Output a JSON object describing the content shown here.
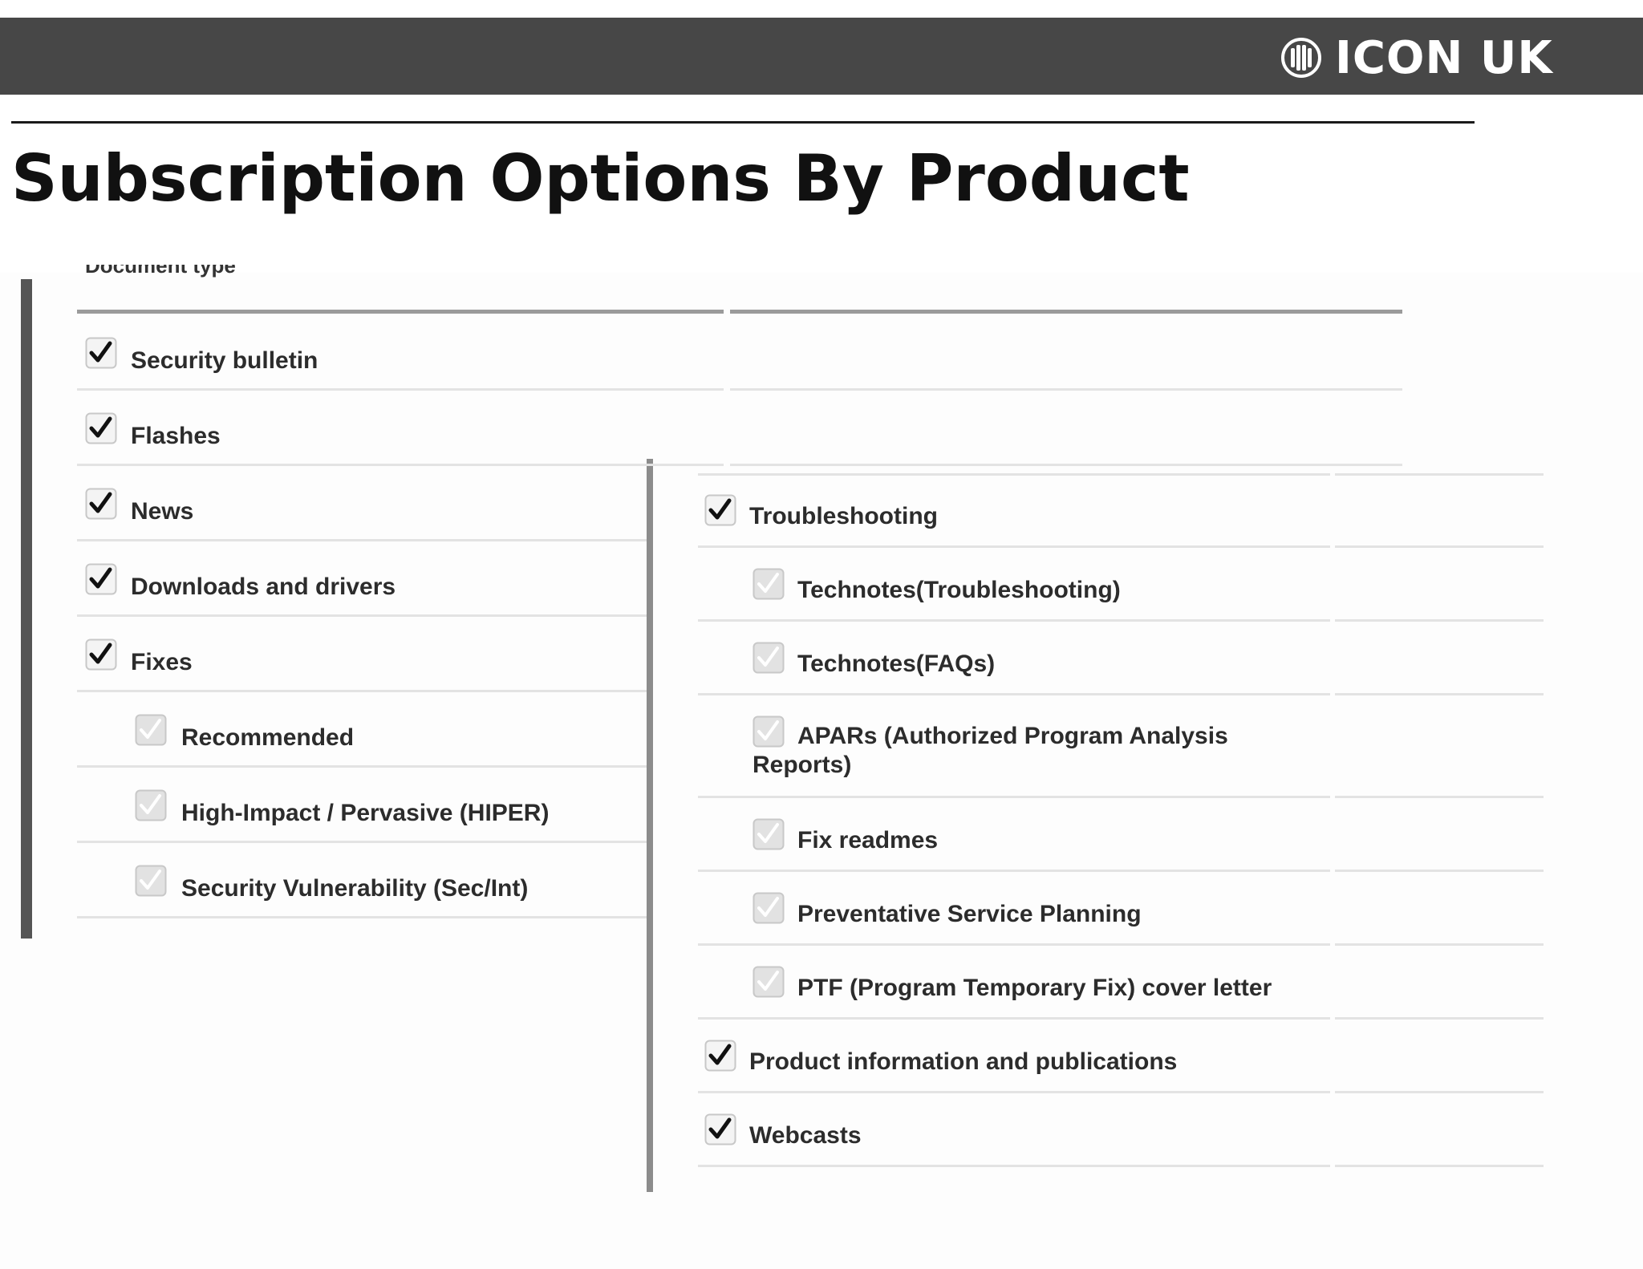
{
  "brand": {
    "name": "ICON UK",
    "icon": "globe-logo-icon"
  },
  "title": "Subscription Options By Product",
  "left_column": {
    "heading": "Document type",
    "items": [
      {
        "label": "Security bulletin",
        "checked": true,
        "disabled": false,
        "level": 0
      },
      {
        "label": "Flashes",
        "checked": true,
        "disabled": false,
        "level": 0
      },
      {
        "label": "News",
        "checked": true,
        "disabled": false,
        "level": 0
      },
      {
        "label": "Downloads and drivers",
        "checked": true,
        "disabled": false,
        "level": 0
      },
      {
        "label": "Fixes",
        "checked": true,
        "disabled": false,
        "level": 0
      },
      {
        "label": "Recommended",
        "checked": true,
        "disabled": true,
        "level": 1
      },
      {
        "label": "High-Impact / Pervasive (HIPER)",
        "checked": true,
        "disabled": true,
        "level": 1
      },
      {
        "label": "Security Vulnerability (Sec/Int)",
        "checked": true,
        "disabled": true,
        "level": 1
      }
    ]
  },
  "right_column": {
    "items": [
      {
        "label": "Troubleshooting",
        "checked": true,
        "disabled": false,
        "level": 0
      },
      {
        "label": "Technotes(Troubleshooting)",
        "checked": true,
        "disabled": true,
        "level": 1
      },
      {
        "label": "Technotes(FAQs)",
        "checked": true,
        "disabled": true,
        "level": 1
      },
      {
        "label": "APARs (Authorized Program Analysis Reports)",
        "checked": true,
        "disabled": true,
        "level": 1
      },
      {
        "label": "Fix readmes",
        "checked": true,
        "disabled": true,
        "level": 1
      },
      {
        "label": "Preventative Service Planning",
        "checked": true,
        "disabled": true,
        "level": 1
      },
      {
        "label": "PTF (Program Temporary Fix) cover letter",
        "checked": true,
        "disabled": true,
        "level": 1
      },
      {
        "label": "Product information and publications",
        "checked": true,
        "disabled": false,
        "level": 0
      },
      {
        "label": "Webcasts",
        "checked": true,
        "disabled": false,
        "level": 0
      }
    ]
  },
  "colors": {
    "header_bar": "#474747",
    "checkbox_border": "#c8c8c8",
    "checkmark": "#111111",
    "checkmark_disabled": "#ffffff",
    "checkbox_disabled_fill": "#e2e2e2",
    "label": "#2c2c2c"
  }
}
